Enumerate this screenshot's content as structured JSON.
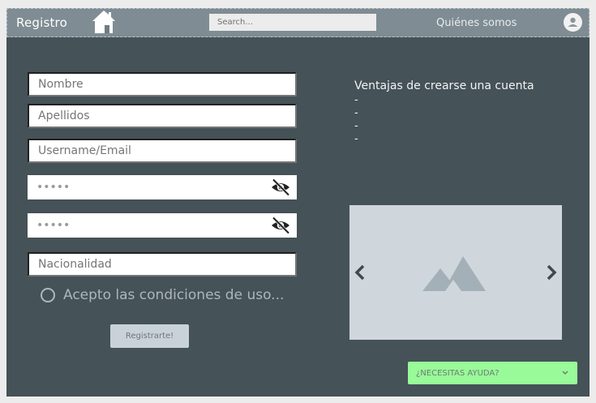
{
  "header": {
    "brand": "Registro",
    "search_placeholder": "Search...",
    "about_link": "Quiénes somos",
    "home_icon": "home-icon",
    "avatar_icon": "user-avatar-icon"
  },
  "form": {
    "nombre_placeholder": "Nombre",
    "apellidos_placeholder": "Apellidos",
    "username_placeholder": "Username/Email",
    "password_value": "•••••",
    "password_confirm_value": "•••••",
    "nacionalidad_placeholder": "Nacionalidad",
    "terms_label": "Acepto las condiciones de uso...",
    "submit_label": "Registrarte!",
    "password_toggle_icon": "eye-off-icon"
  },
  "benefits": {
    "title": "Ventajas de crearse una cuenta",
    "items": [
      "-",
      "-",
      "-",
      "-"
    ]
  },
  "carousel": {
    "image_icon": "mountain-image-icon",
    "prev_icon": "chevron-left-icon",
    "next_icon": "chevron-right-icon"
  },
  "help": {
    "label": "¿NECESITAS AYUDA?",
    "chevron_icon": "chevron-down-icon"
  },
  "colors": {
    "background": "#455257",
    "topbar": "#7f8c93",
    "help_button": "#98fa98",
    "carousel": "#cfd6dc"
  }
}
